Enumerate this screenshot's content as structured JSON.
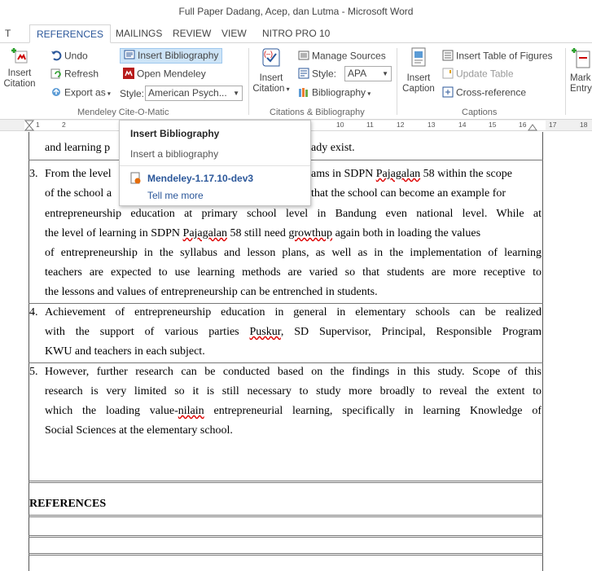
{
  "window": {
    "title": "Full Paper Dadang, Acep, dan Lutma - Microsoft Word"
  },
  "tabs": [
    {
      "label": "T"
    },
    {
      "label": "REFERENCES"
    },
    {
      "label": "MAILINGS"
    },
    {
      "label": "REVIEW"
    },
    {
      "label": "VIEW"
    },
    {
      "label": "NITRO PRO 10"
    }
  ],
  "ribbon": {
    "insert_citation": {
      "line1": "Insert",
      "line2": "Citation"
    },
    "mendeley": {
      "undo": "Undo",
      "refresh": "Refresh",
      "export_as": "Export as",
      "insert_bibliography": "Insert Bibliography",
      "open_mendeley": "Open Mendeley",
      "style_label": "Style:",
      "style_value": "American Psych...",
      "group_label": "Mendeley Cite-O-Matic"
    },
    "citations": {
      "insert_citation": {
        "line1": "Insert",
        "line2": "Citation"
      },
      "manage_sources": "Manage Sources",
      "style_label": "Style:",
      "style_value": "APA",
      "bibliography": "Bibliography",
      "group_label": "Citations & Bibliography"
    },
    "captions": {
      "insert_caption": {
        "line1": "Insert",
        "line2": "Caption"
      },
      "insert_table_of_figures": "Insert Table of Figures",
      "update_table": "Update Table",
      "cross_reference": "Cross-reference",
      "group_label": "Captions"
    },
    "index": {
      "line1": "Mark",
      "line2": "Entry"
    }
  },
  "ruler": {
    "left_ticks": [
      "1",
      "2"
    ],
    "right_ticks": [
      "10",
      "11",
      "12",
      "13",
      "14",
      "15",
      "16",
      "17",
      "18"
    ]
  },
  "popup": {
    "title": "Insert Bibliography",
    "description": "Insert a bibliography",
    "addin_name": "Mendeley-1.17.10-dev3",
    "tell_me_more": "Tell me more"
  },
  "document": {
    "line0_left": "and learning p",
    "line0_right": "ady exist.",
    "item3": {
      "number": "3.",
      "l1_left": "From the level",
      "l1_right_a": "ams in SDPN ",
      "l1_right_b": "Pajagalan",
      "l1_right_c": " 58 within the scope",
      "l2_left": "of the school a",
      "l2_right": "that the school can become an example for",
      "l3": "entrepreneurship education at primary school level in Bandung even national level. While at",
      "l4_a": "the level of learning in SDPN ",
      "l4_b": "Pajagalan",
      "l4_c": " 58 still need ",
      "l4_d": "growthup",
      "l4_e": " again both in loading the values",
      "l5": "of entrepreneurship in the syllabus and lesson plans, as well as in the implementation of learning",
      "l6": "teachers are expected to use learning methods are varied so that students are more receptive to",
      "l7": "the lessons and values of entrepreneurship can be entrenched in students."
    },
    "item4": {
      "number": "4.",
      "l1": "Achievement of entrepreneurship education in general in elementary schools can be realized",
      "l2_a": "with the support of various parties ",
      "l2_b": "Puskur",
      "l2_c": ", SD Supervisor, Principal, Responsible Program",
      "l3": "KWU and teachers in each subject."
    },
    "item5": {
      "number": "5.",
      "l1": "However, further research can be conducted based on the findings in this study. Scope of this",
      "l2": "research is very limited so it is still necessary to study more broadly to reveal the extent to",
      "l3_a": "which the loading value-",
      "l3_b": "nilain",
      "l3_c": " entrepreneurial learning, specifically in learning Knowledge of",
      "l4": "Social Sciences at the elementary school."
    },
    "heading": "REFERENCES"
  },
  "colors": {
    "accent": "#2b579a",
    "ribbon_highlight": "#cde4f7"
  }
}
